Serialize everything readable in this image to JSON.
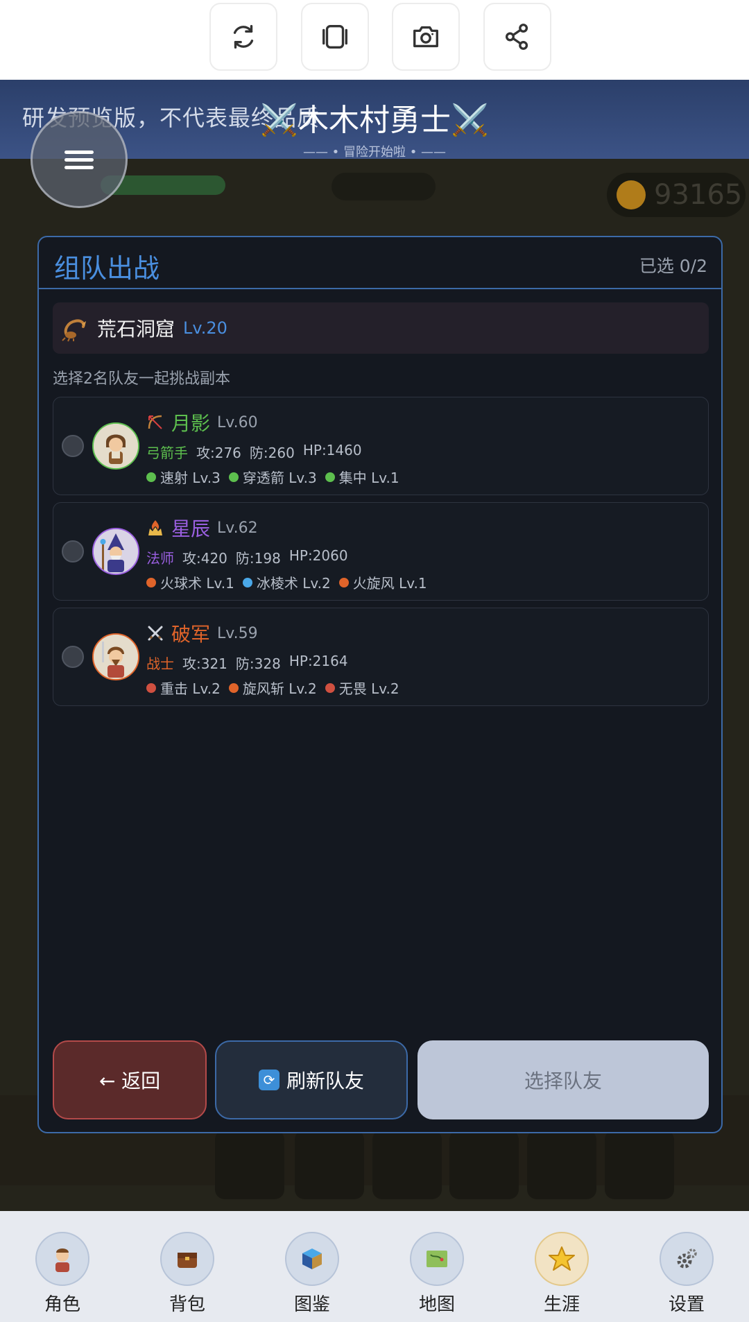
{
  "toolbar": {
    "buttons": [
      {
        "icon": "refresh-icon"
      },
      {
        "icon": "layers-icon"
      },
      {
        "icon": "camera-icon"
      },
      {
        "icon": "share-icon"
      }
    ]
  },
  "header": {
    "preview_text": "研发预览版，不代表最终品质",
    "title": "⚔️木木村勇士⚔️",
    "subtitle": "—— • 冒险开始啦 • ——"
  },
  "background": {
    "gold": "93165"
  },
  "modal": {
    "title": "组队出战",
    "selected_count": "已选 0/2",
    "dungeon": {
      "name": "荒石洞窟",
      "level": "Lv.20"
    },
    "hint": "选择2名队友一起挑战副本",
    "teammates": [
      {
        "name": "月影",
        "level": "Lv.60",
        "class": "弓箭手",
        "atk": "攻:276",
        "def": "防:260",
        "hp": "HP:1460",
        "color": "#5dbf4e",
        "skills": [
          {
            "label": "速射 Lv.3",
            "color": "#5dbf4e"
          },
          {
            "label": "穿透箭 Lv.3",
            "color": "#5dbf4e"
          },
          {
            "label": "集中 Lv.1",
            "color": "#5dbf4e"
          }
        ]
      },
      {
        "name": "星辰",
        "level": "Lv.62",
        "class": "法师",
        "atk": "攻:420",
        "def": "防:198",
        "hp": "HP:2060",
        "color": "#9a5fe0",
        "skills": [
          {
            "label": "火球术 Lv.1",
            "color": "#e0642a"
          },
          {
            "label": "冰棱术 Lv.2",
            "color": "#4aa8e8"
          },
          {
            "label": "火旋风 Lv.1",
            "color": "#e0642a"
          }
        ]
      },
      {
        "name": "破军",
        "level": "Lv.59",
        "class": "战士",
        "atk": "攻:321",
        "def": "防:328",
        "hp": "HP:2164",
        "color": "#e0642a",
        "skills": [
          {
            "label": "重击 Lv.2",
            "color": "#d05040"
          },
          {
            "label": "旋风斩 Lv.2",
            "color": "#e0642a"
          },
          {
            "label": "无畏 Lv.2",
            "color": "#d05040"
          }
        ]
      }
    ],
    "buttons": {
      "back": "← 返回",
      "refresh": "刷新队友",
      "select": "选择队友"
    }
  },
  "bottom_nav": [
    {
      "label": "角色",
      "icon": "character-icon"
    },
    {
      "label": "背包",
      "icon": "backpack-icon"
    },
    {
      "label": "图鉴",
      "icon": "codex-icon"
    },
    {
      "label": "地图",
      "icon": "map-icon"
    },
    {
      "label": "生涯",
      "icon": "star-icon"
    },
    {
      "label": "设置",
      "icon": "gear-icon"
    }
  ]
}
